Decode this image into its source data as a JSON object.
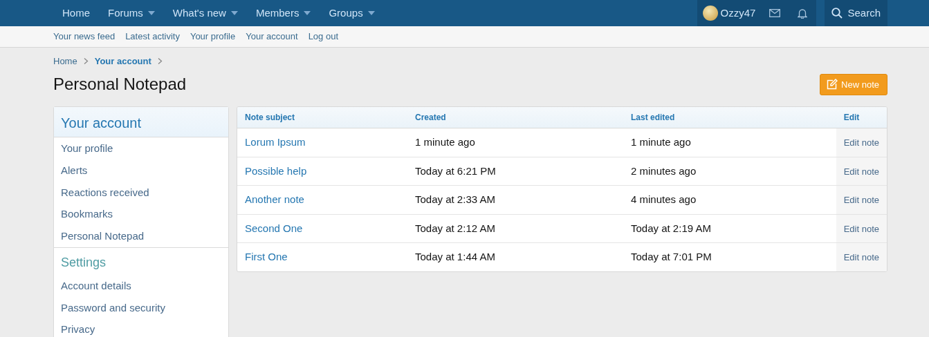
{
  "nav": {
    "items": [
      {
        "label": "Home",
        "has_menu": false
      },
      {
        "label": "Forums",
        "has_menu": true
      },
      {
        "label": "What's new",
        "has_menu": true
      },
      {
        "label": "Members",
        "has_menu": true
      },
      {
        "label": "Groups",
        "has_menu": true
      }
    ],
    "user": "Ozzy47",
    "search": "Search"
  },
  "subnav": [
    "Your news feed",
    "Latest activity",
    "Your profile",
    "Your account",
    "Log out"
  ],
  "breadcrumb": [
    {
      "label": "Home",
      "current": false
    },
    {
      "label": "Your account",
      "current": true
    }
  ],
  "title": "Personal Notepad",
  "new_note_button": "New note",
  "sidebar": [
    {
      "heading": "Your account",
      "kind": "block",
      "items": [
        "Your profile",
        "Alerts",
        "Reactions received",
        "Bookmarks",
        "Personal Notepad"
      ]
    },
    {
      "heading": "Settings",
      "kind": "plain",
      "items": [
        "Account details",
        "Password and security",
        "Privacy"
      ]
    }
  ],
  "table": {
    "columns": [
      "Note subject",
      "Created",
      "Last edited",
      "Edit"
    ],
    "rows": [
      {
        "subject": "Lorum Ipsum",
        "created": "1 minute ago",
        "last_edited": "1 minute ago",
        "edit": "Edit note"
      },
      {
        "subject": "Possible help",
        "created": "Today at 6:21 PM",
        "last_edited": "2 minutes ago",
        "edit": "Edit note"
      },
      {
        "subject": "Another note",
        "created": "Today at 2:33 AM",
        "last_edited": "4 minutes ago",
        "edit": "Edit note"
      },
      {
        "subject": "Second One",
        "created": "Today at 2:12 AM",
        "last_edited": "Today at 2:19 AM",
        "edit": "Edit note"
      },
      {
        "subject": "First One",
        "created": "Today at 1:44 AM",
        "last_edited": "Today at 7:01 PM",
        "edit": "Edit note"
      }
    ]
  }
}
